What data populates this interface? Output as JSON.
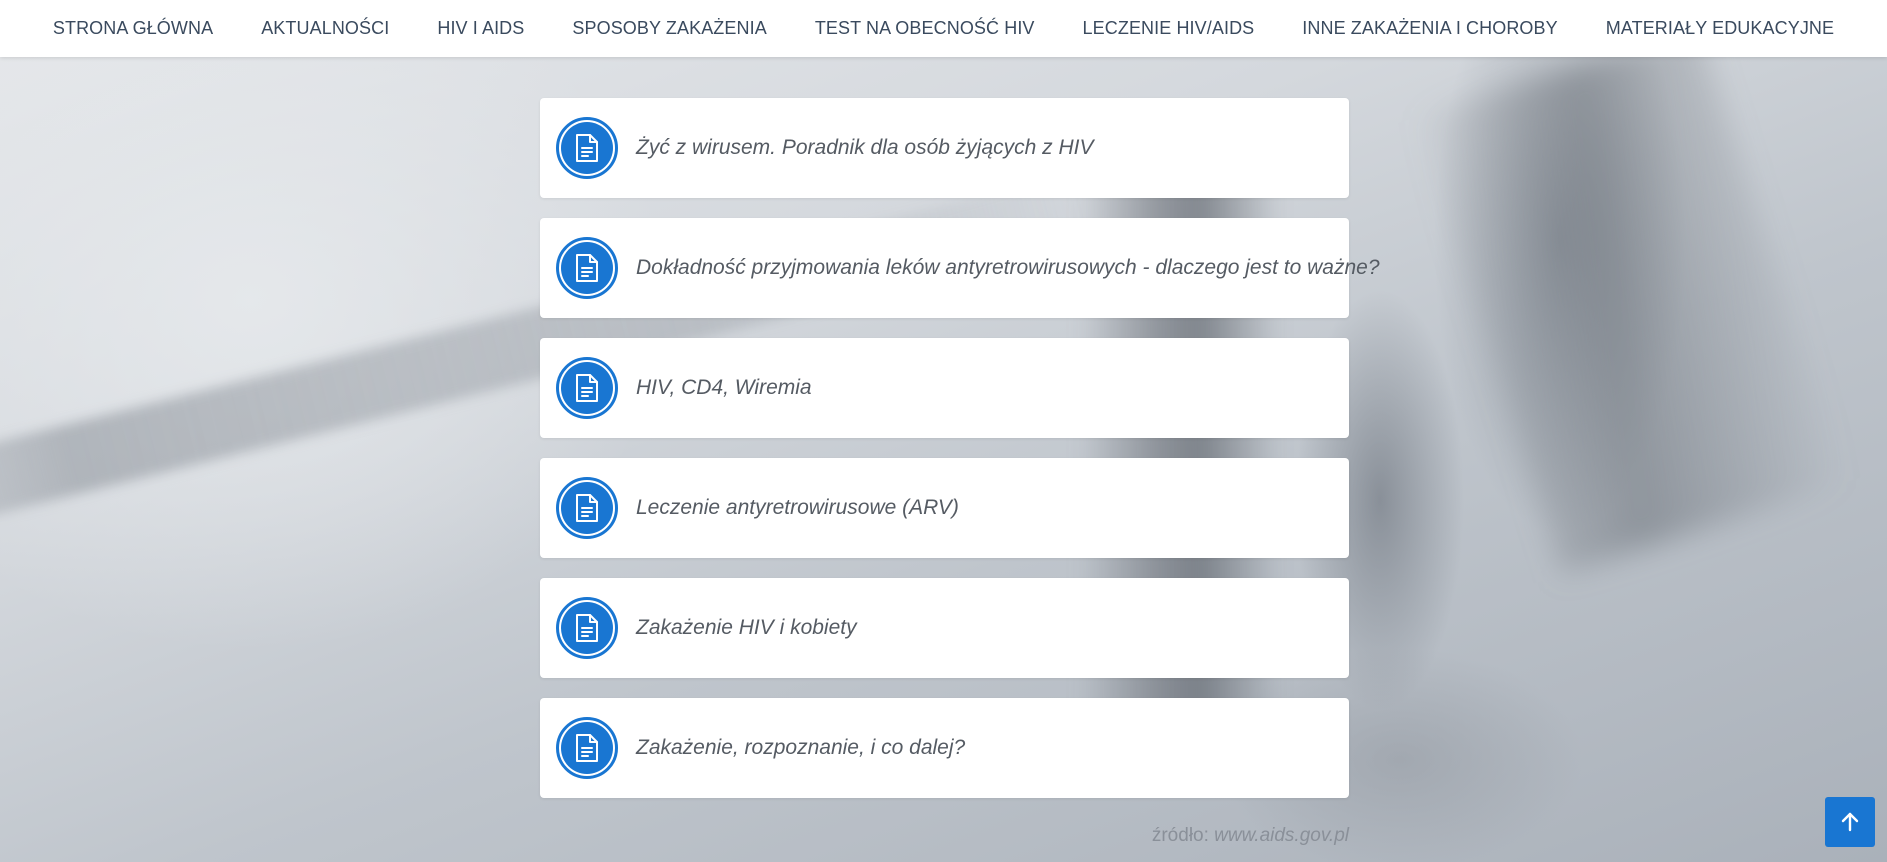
{
  "nav": {
    "items": [
      {
        "label": "STRONA GŁÓWNA"
      },
      {
        "label": "AKTUALNOŚCI"
      },
      {
        "label": "HIV I AIDS"
      },
      {
        "label": "SPOSOBY ZAKAŻENIA"
      },
      {
        "label": "TEST NA OBECNOŚĆ HIV"
      },
      {
        "label": "LECZENIE HIV/AIDS"
      },
      {
        "label": "INNE ZAKAŻENIA I CHOROBY"
      },
      {
        "label": "MATERIAŁY EDUKACYJNE"
      }
    ]
  },
  "documents": [
    {
      "title": "Żyć z wirusem. Poradnik dla osób żyjących z HIV",
      "icon": "document-icon"
    },
    {
      "title": "Dokładność przyjmowania leków antyretrowirusowych - dlaczego jest to ważne?",
      "icon": "document-icon"
    },
    {
      "title": "HIV, CD4, Wiremia",
      "icon": "document-icon"
    },
    {
      "title": "Leczenie antyretrowirusowe (ARV)",
      "icon": "document-icon"
    },
    {
      "title": "Zakażenie HIV i kobiety",
      "icon": "document-icon"
    },
    {
      "title": "Zakażenie, rozpoznanie, i co dalej?",
      "icon": "document-icon"
    }
  ],
  "source": {
    "label": "źródło:",
    "link": "www.aids.gov.pl"
  },
  "scroll_top": {
    "icon": "arrow-up-icon"
  },
  "colors": {
    "accent": "#1976d2",
    "nav_text": "#3a4a5e",
    "card_text": "#555b63"
  }
}
